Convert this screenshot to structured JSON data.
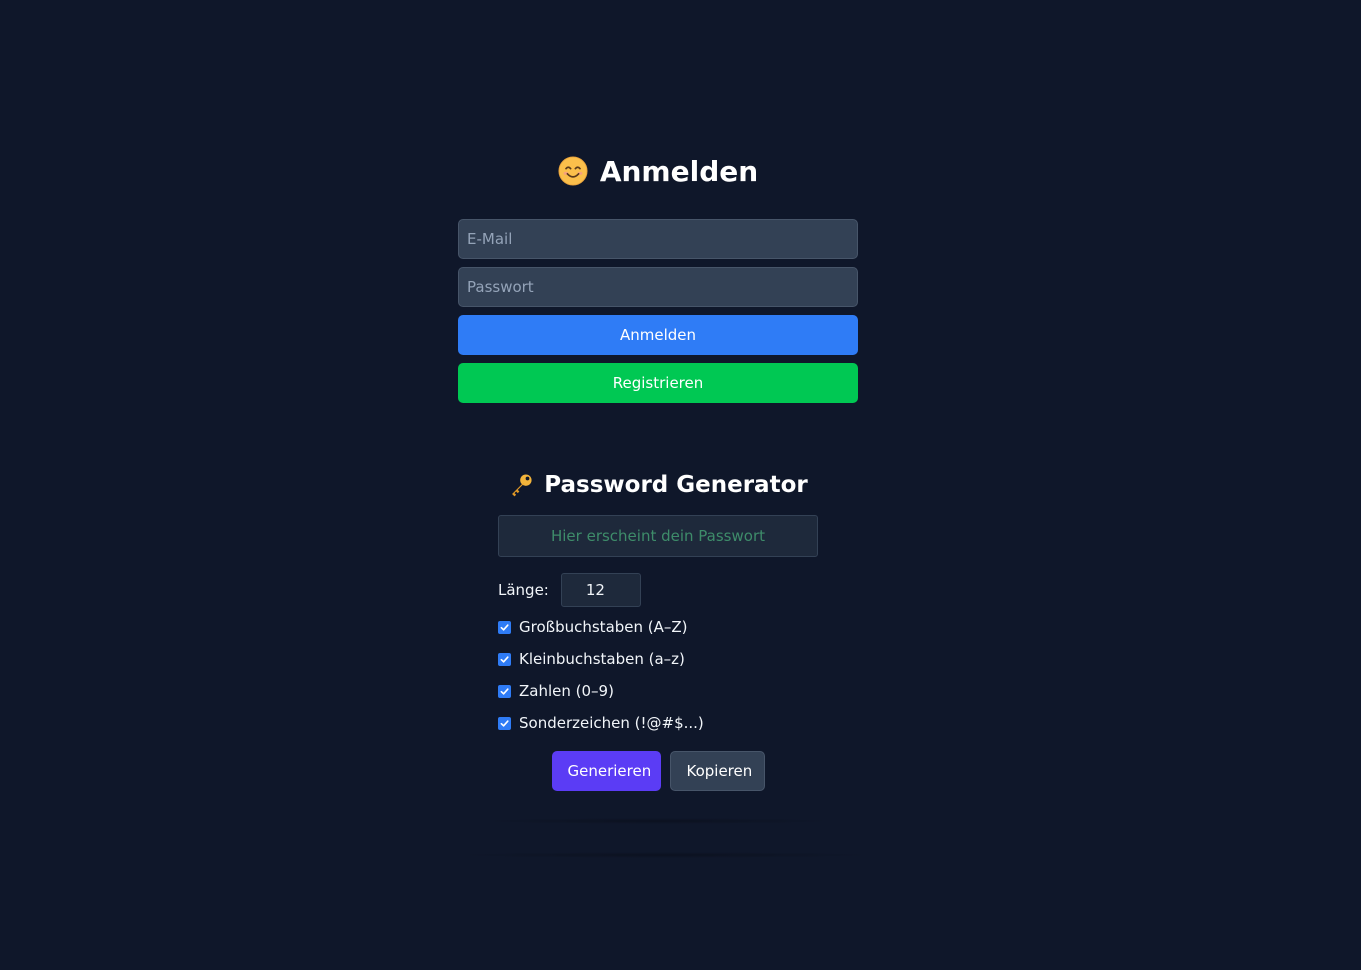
{
  "login": {
    "title": "Anmelden",
    "title_icon": "smiling-face-icon",
    "email_placeholder": "E-Mail",
    "email_value": "",
    "password_placeholder": "Passwort",
    "password_value": "",
    "login_button": "Anmelden",
    "register_button": "Registrieren"
  },
  "generator": {
    "title": "Password Generator",
    "title_icon": "key-icon",
    "output_placeholder": "Hier erscheint dein Passwort",
    "length_label": "Länge:",
    "length_value": "12",
    "options": [
      {
        "label": "Großbuchstaben (A–Z)",
        "checked": true
      },
      {
        "label": "Kleinbuchstaben (a–z)",
        "checked": true
      },
      {
        "label": "Zahlen (0–9)",
        "checked": true
      },
      {
        "label": "Sonderzeichen (!@#$...)",
        "checked": true
      }
    ],
    "generate_button": "Generieren",
    "copy_button": "Kopieren"
  },
  "colors": {
    "background": "#0f172a",
    "login_button": "#2f7cf6",
    "register_button": "#00c853",
    "generate_button": "#5b3cf5",
    "copy_button": "#334155",
    "output_text": "#3e8c6a"
  }
}
